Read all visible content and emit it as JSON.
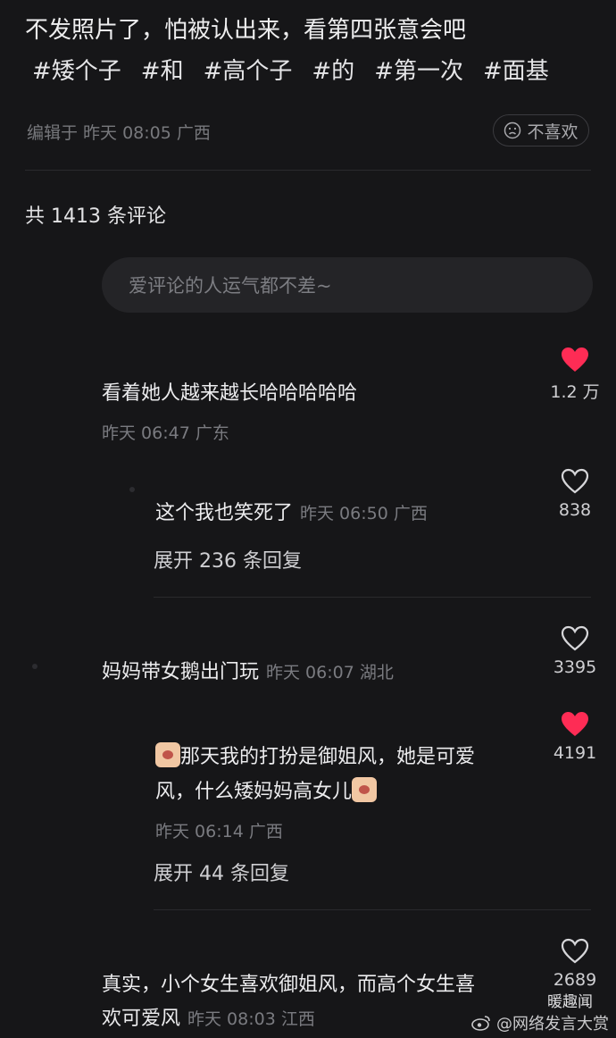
{
  "post": {
    "caption": "不发照片了，怕被认出来，看第四张意会吧",
    "hashtags": [
      "#矮个子",
      "#和",
      "#高个子",
      "#的",
      "#第一次",
      "#面基"
    ],
    "edit_meta": "编辑于 昨天 08:05 广西",
    "dislike_label": "不喜欢"
  },
  "comments_header": {
    "count_text": "共 1413 条评论"
  },
  "comment_input": {
    "placeholder": "爱评论的人运气都不差~"
  },
  "comments": [
    {
      "text": "看着她人越来越长哈哈哈哈哈",
      "meta": "昨天 06:47 广东",
      "likes": "1.2 万",
      "liked": true
    },
    {
      "text": "这个我也笑死了",
      "meta": "昨天 06:50 广西",
      "likes": "838",
      "liked": false,
      "expand": "展开 236 条回复"
    },
    {
      "text": "妈妈带女鹅出门玩",
      "meta": "昨天 06:07 湖北",
      "likes": "3395",
      "liked": false
    },
    {
      "text_line1": "那天我的打扮是御姐风，她是可爱",
      "text_line2": "风，什么矮妈妈高女儿",
      "meta": "昨天 06:14 广西",
      "likes": "4191",
      "liked": true,
      "expand": "展开 44 条回复"
    },
    {
      "text_line1": "真实，小个女生喜欢御姐风，而高个女生喜",
      "text_line2": "欢可爱风",
      "meta": "昨天 08:03 江西",
      "likes": "2689",
      "liked": false
    }
  ],
  "watermark": {
    "top": "暖趣闻",
    "bottom": "@网络发言大赏"
  },
  "colors": {
    "background": "#161618",
    "heart_liked": "#fe2c55",
    "text_muted": "#7a7b80"
  }
}
